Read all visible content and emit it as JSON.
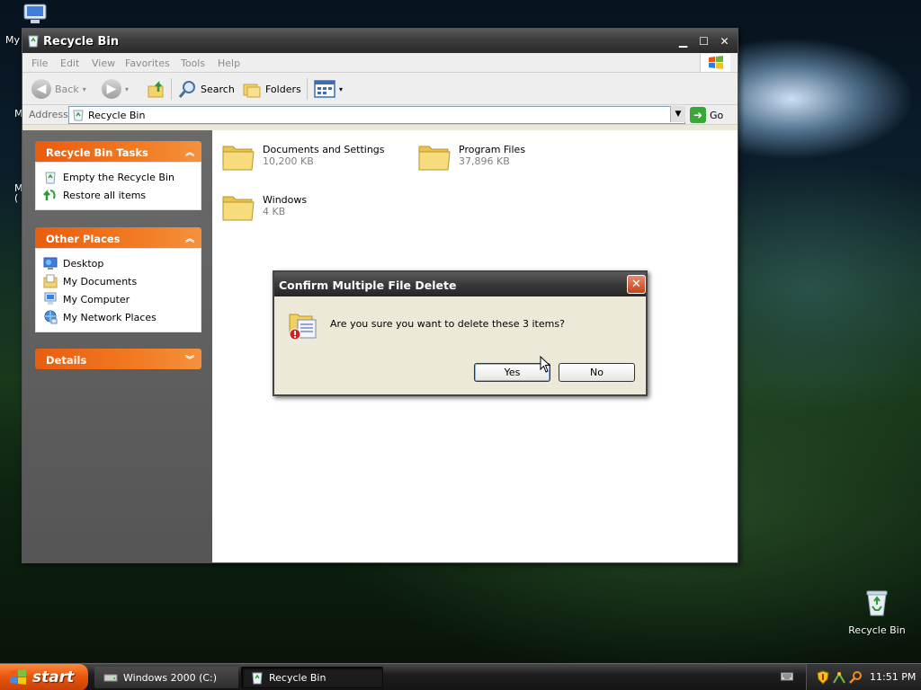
{
  "desktop": {
    "my_computer_label": "My",
    "partial_label_1": "M",
    "partial_label_2": "M",
    "partial_label_3": "(",
    "recycle_bin_label": "Recycle Bin"
  },
  "window": {
    "title": "Recycle Bin",
    "menu": [
      "File",
      "Edit",
      "View",
      "Favorites",
      "Tools",
      "Help"
    ],
    "toolbar": {
      "back": "Back",
      "search": "Search",
      "folders": "Folders"
    },
    "address": {
      "label": "Address",
      "value": "Recycle Bin",
      "go": "Go"
    },
    "tasks_panel": {
      "title": "Recycle Bin Tasks",
      "items": [
        "Empty the Recycle Bin",
        "Restore all items"
      ]
    },
    "places_panel": {
      "title": "Other Places",
      "items": [
        "Desktop",
        "My Documents",
        "My Computer",
        "My Network Places"
      ]
    },
    "details_panel": {
      "title": "Details"
    },
    "files": [
      {
        "name": "Documents and Settings",
        "size": "10,200 KB"
      },
      {
        "name": "Program Files",
        "size": "37,896 KB"
      },
      {
        "name": "Windows",
        "size": "4 KB"
      }
    ]
  },
  "dialog": {
    "title": "Confirm Multiple File Delete",
    "message": "Are you sure you want to delete these 3 items?",
    "yes": "Yes",
    "no": "No"
  },
  "taskbar": {
    "start": "start",
    "tasks": [
      "Windows 2000 (C:)",
      "Recycle Bin"
    ],
    "clock": "11:51 PM"
  },
  "colors": {
    "accent_orange": "#e85d10",
    "title_dark": "#3c3c3c"
  }
}
